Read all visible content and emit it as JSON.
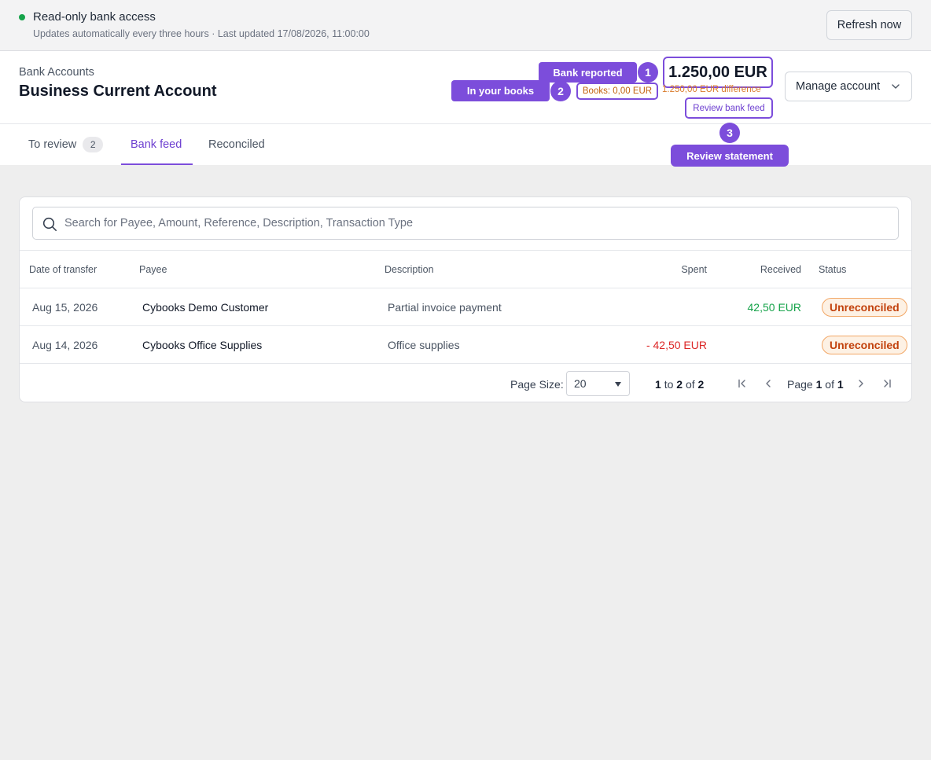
{
  "status": {
    "title": "Read-only bank access",
    "subtitle": "Updates automatically every three hours · Last updated 17/08/2026, 11:00:00",
    "refresh_label": "Refresh now",
    "dot_color": "#16a34a"
  },
  "header": {
    "breadcrumb": "Bank Accounts",
    "title": "Business Current Account",
    "bank_balance": "1.250,00 EUR",
    "books_balance": "Books: 0,00 EUR",
    "difference": "1.250,00 EUR difference",
    "review_link": "Review bank feed",
    "manage_label": "Manage account"
  },
  "annotations": [
    {
      "number": "1",
      "label": "Bank reported"
    },
    {
      "number": "2",
      "label": "In your books"
    },
    {
      "number": "3",
      "label": "Review statement"
    }
  ],
  "tabs": [
    {
      "label": "To review",
      "count": "2"
    },
    {
      "label": "Bank feed"
    },
    {
      "label": "Reconciled"
    }
  ],
  "active_tab": "Bank feed",
  "search": {
    "placeholder": "Search for Payee, Amount, Reference, Description, Transaction Type"
  },
  "table": {
    "columns": [
      "Date of transfer",
      "Payee",
      "Description",
      "Spent",
      "Received",
      "Status"
    ],
    "rows": [
      {
        "date": "Aug 15, 2026",
        "payee": "Cybooks Demo Customer",
        "description": "Partial invoice payment",
        "spent": "",
        "received": "42,50 EUR",
        "status": "Unreconciled"
      },
      {
        "date": "Aug 14, 2026",
        "payee": "Cybooks Office Supplies",
        "description": "Office supplies",
        "spent": "- 42,50 EUR",
        "received": "",
        "status": "Unreconciled"
      }
    ]
  },
  "pagination": {
    "page_size_label": "Page Size:",
    "page_size": "20",
    "range_from": "1",
    "range_to": "2",
    "range_total": "2",
    "to_word": "to",
    "of_word": "of",
    "page_word": "Page",
    "page_current": "1",
    "page_total": "1"
  },
  "colors": {
    "accent": "#7c4ddb",
    "spent": "#dc2626",
    "received": "#16a34a",
    "warning": "#c2410c"
  }
}
